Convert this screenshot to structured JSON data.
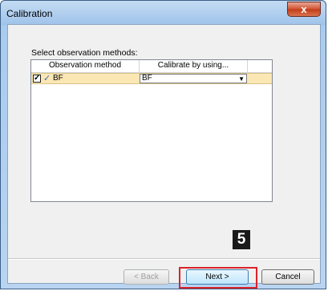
{
  "window": {
    "title": "Calibration",
    "close_glyph": "x"
  },
  "prompt": "Select observation methods:",
  "table": {
    "columns": [
      "Observation method",
      "Calibrate by using..."
    ],
    "rows": [
      {
        "checked": true,
        "method": "BF",
        "calibrate_by": "BF"
      }
    ]
  },
  "step_badge": "5",
  "buttons": {
    "back": "< Back",
    "next": "Next >",
    "cancel": "Cancel"
  },
  "colors": {
    "highlight": "#d9232b",
    "row_selected": "#fbe7b4",
    "title_bar": "#a9cbee"
  }
}
